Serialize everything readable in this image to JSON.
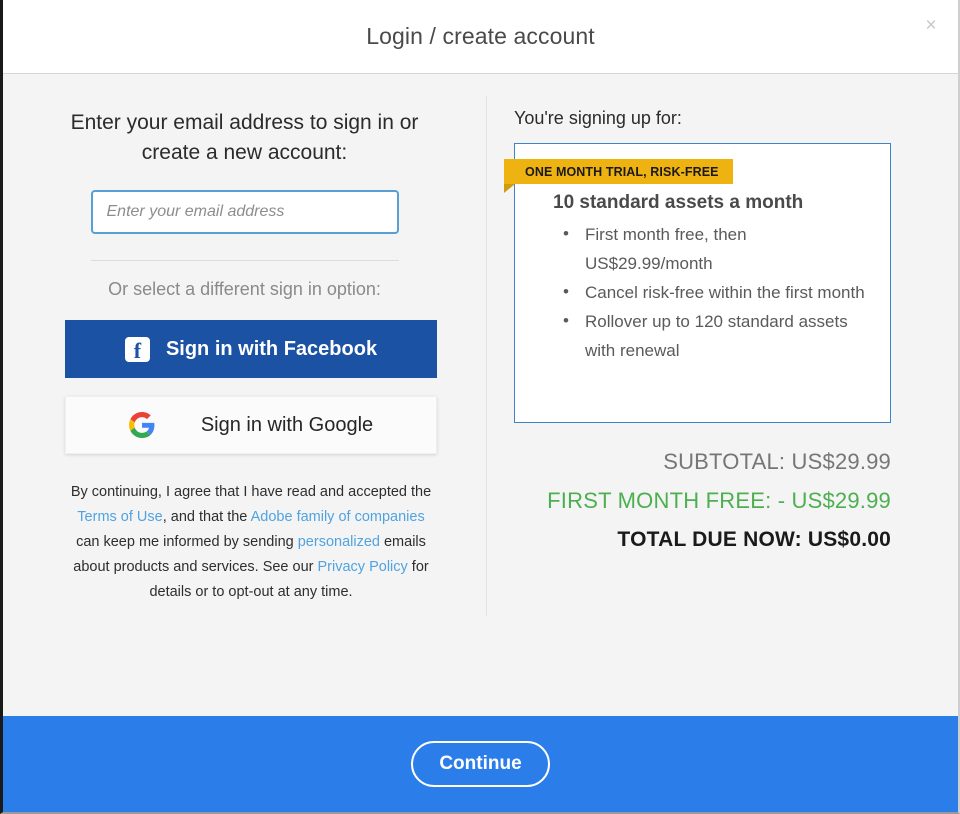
{
  "header": {
    "title": "Login / create account",
    "close_icon": "close-icon",
    "close_glyph": "×"
  },
  "left": {
    "heading": "Enter your email address to sign in or create a new account:",
    "email_placeholder": "Enter your email address",
    "email_value": "",
    "other_option_label": "Or select a different sign in option:",
    "facebook_button": {
      "label": "Sign in with Facebook",
      "icon": "facebook-icon",
      "glyph": "f",
      "bg_color": "#1b52a4",
      "text_color": "#ffffff"
    },
    "google_button": {
      "label": "Sign in with Google",
      "icon": "google-icon",
      "bg_color": "#fbfbfb",
      "text_color": "#262626"
    },
    "legal": {
      "part1": "By continuing, I agree that I have read and accepted the ",
      "link1": "Terms of Use",
      "part2": ", and that the ",
      "link2": "Adobe family of companies",
      "part3": " can keep me informed by sending ",
      "link3": "personalized",
      "part4": " emails about products and services. See our ",
      "link4": "Privacy Policy",
      "part5": " for details or to opt-out at any time.",
      "link_color": "#51a3e0"
    }
  },
  "right": {
    "signup_label": "You're signing up for:",
    "plan": {
      "ribbon": "ONE MONTH TRIAL, RISK-FREE",
      "ribbon_color": "#eeb211",
      "title": "10 standard assets a month",
      "features": [
        "First month free, then US$29.99/month",
        "Cancel risk-free within the first month",
        "Rollover up to 120 standard assets with renewal"
      ],
      "border_color": "#3d85c6"
    },
    "totals": {
      "subtotal": "SUBTOTAL: US$29.99",
      "first_month_free": "FIRST MONTH FREE: - US$29.99",
      "first_month_free_color": "#4caf50",
      "total_due": "TOTAL DUE NOW: US$0.00"
    }
  },
  "footer": {
    "continue_label": "Continue",
    "bg_color": "#2b7de9"
  }
}
